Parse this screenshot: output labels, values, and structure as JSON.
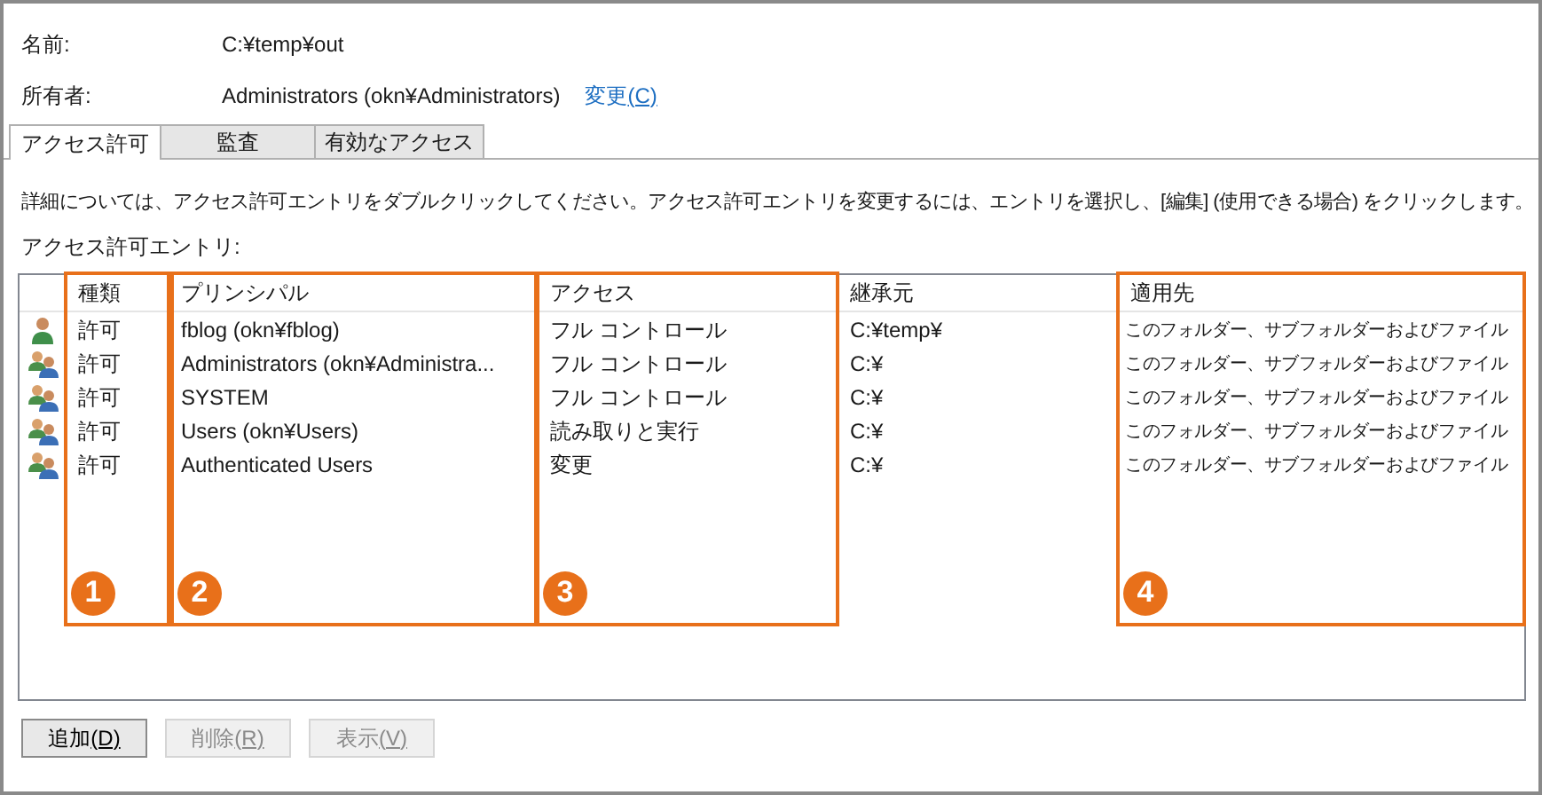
{
  "fields": [
    {
      "label": "名前:",
      "value": "C:¥temp¥out"
    },
    {
      "label": "所有者:",
      "value": "Administrators (okn¥Administrators)",
      "link": {
        "label": "変更",
        "access_key": "(C)"
      }
    }
  ],
  "tabs": [
    {
      "label": "アクセス許可",
      "selected": true
    },
    {
      "label": "監査",
      "selected": false
    },
    {
      "label": "有効なアクセス",
      "selected": false
    }
  ],
  "description": "詳細については、アクセス許可エントリをダブルクリックしてください。アクセス許可エントリを変更するには、エントリを選択し、[編集] (使用できる場合) をクリックします。",
  "list_label": "アクセス許可エントリ:",
  "table": {
    "columns": [
      {
        "label": "種類",
        "callout": "1"
      },
      {
        "label": "プリンシパル",
        "callout": "2"
      },
      {
        "label": "アクセス",
        "callout": "3"
      },
      {
        "label": "継承元"
      },
      {
        "label": "適用先",
        "callout": "4"
      }
    ],
    "rows": [
      {
        "kind": "user",
        "type": "許可",
        "principal": "fblog (okn¥fblog)",
        "access": "フル コントロール",
        "inherited_from": "C:¥temp¥",
        "applies_to": "このフォルダー、サブフォルダーおよびファイル"
      },
      {
        "kind": "group",
        "type": "許可",
        "principal": "Administrators (okn¥Administra...",
        "access": "フル コントロール",
        "inherited_from": "C:¥",
        "applies_to": "このフォルダー、サブフォルダーおよびファイル"
      },
      {
        "kind": "group",
        "type": "許可",
        "principal": "SYSTEM",
        "access": "フル コントロール",
        "inherited_from": "C:¥",
        "applies_to": "このフォルダー、サブフォルダーおよびファイル"
      },
      {
        "kind": "group",
        "type": "許可",
        "principal": "Users (okn¥Users)",
        "access": "読み取りと実行",
        "inherited_from": "C:¥",
        "applies_to": "このフォルダー、サブフォルダーおよびファイル"
      },
      {
        "kind": "group",
        "type": "許可",
        "principal": "Authenticated Users",
        "access": "変更",
        "inherited_from": "C:¥",
        "applies_to": "このフォルダー、サブフォルダーおよびファイル"
      }
    ]
  },
  "buttons": [
    {
      "label": "追加",
      "access_key": "(D)",
      "disabled": false
    },
    {
      "label": "削除",
      "access_key": "(R)",
      "disabled": true
    },
    {
      "label": "表示",
      "access_key": "(V)",
      "disabled": true
    }
  ]
}
